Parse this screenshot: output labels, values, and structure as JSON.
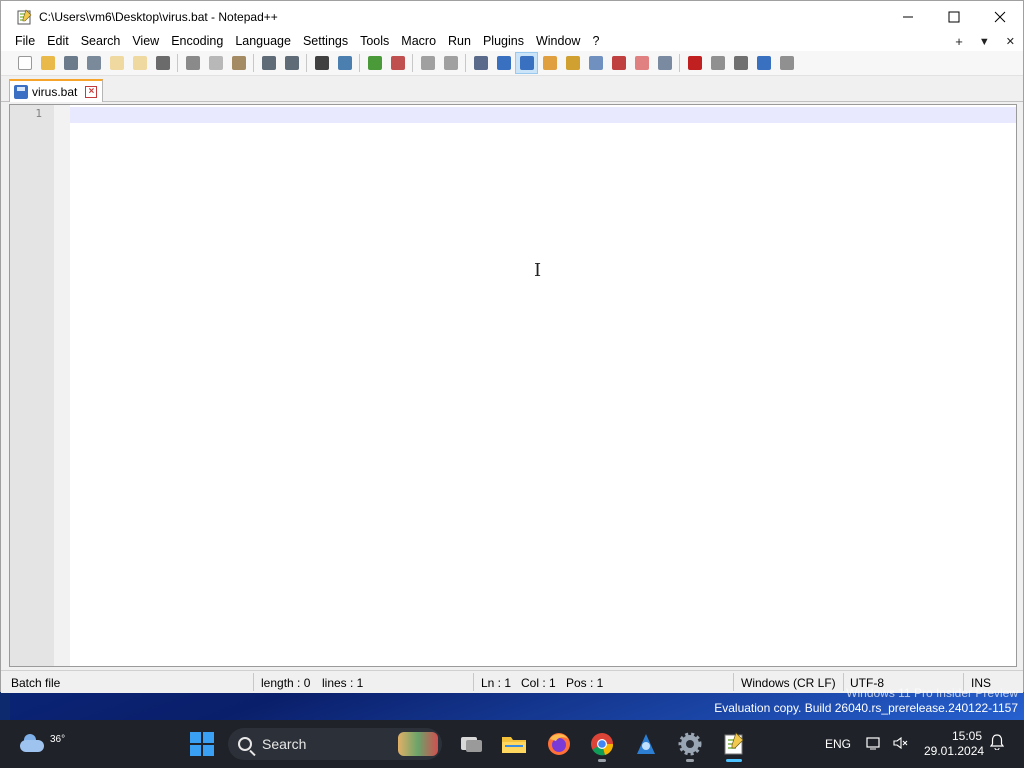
{
  "window": {
    "title": "C:\\Users\\vm6\\Desktop\\virus.bat - Notepad++",
    "controls": [
      "minimize-icon",
      "maximize-icon",
      "close-icon"
    ]
  },
  "menu": {
    "items": [
      "File",
      "Edit",
      "Search",
      "View",
      "Encoding",
      "Language",
      "Settings",
      "Tools",
      "Macro",
      "Run",
      "Plugins",
      "Window",
      "?"
    ],
    "right": [
      "+",
      "▼",
      "✕"
    ]
  },
  "toolbar": {
    "buttons": [
      {
        "name": "new-file-icon",
        "color": "#ffffff"
      },
      {
        "name": "open-file-icon",
        "color": "#e9b949"
      },
      {
        "name": "save-icon",
        "color": "#6b7b8c"
      },
      {
        "name": "save-all-icon",
        "color": "#7a8a9a"
      },
      {
        "name": "close-file-icon",
        "color": "#f0d9a0"
      },
      {
        "name": "close-all-icon",
        "color": "#f0d9a0"
      },
      {
        "name": "print-icon",
        "color": "#6b6b6b"
      },
      {
        "name": "sep"
      },
      {
        "name": "cut-icon",
        "color": "#8a8a8a"
      },
      {
        "name": "copy-icon",
        "color": "#b8b8b8"
      },
      {
        "name": "paste-icon",
        "color": "#a58b63"
      },
      {
        "name": "sep"
      },
      {
        "name": "undo-icon",
        "color": "#606b78"
      },
      {
        "name": "redo-icon",
        "color": "#606b78"
      },
      {
        "name": "sep"
      },
      {
        "name": "find-icon",
        "color": "#404040"
      },
      {
        "name": "replace-icon",
        "color": "#4a7fb0"
      },
      {
        "name": "sep"
      },
      {
        "name": "zoom-in-icon",
        "color": "#4a9a3a"
      },
      {
        "name": "zoom-out-icon",
        "color": "#c05050"
      },
      {
        "name": "sep"
      },
      {
        "name": "sync-vertical-icon",
        "color": "#a0a0a0"
      },
      {
        "name": "sync-horizontal-icon",
        "color": "#a0a0a0"
      },
      {
        "name": "sep"
      },
      {
        "name": "word-wrap-icon",
        "color": "#5a6a8a"
      },
      {
        "name": "show-all-chars-icon",
        "color": "#3a70c0"
      },
      {
        "name": "indent-guide-icon",
        "color": "#3a70c0",
        "active": true
      },
      {
        "name": "udl-icon",
        "color": "#e0a040"
      },
      {
        "name": "doc-map-icon",
        "color": "#d0a030"
      },
      {
        "name": "doc-list-icon",
        "color": "#7090c0"
      },
      {
        "name": "function-list-icon",
        "color": "#c04040"
      },
      {
        "name": "folder-as-workspace-icon",
        "color": "#e08080"
      },
      {
        "name": "monitoring-icon",
        "color": "#7a8aa0"
      },
      {
        "name": "sep"
      },
      {
        "name": "record-macro-icon",
        "color": "#c02020"
      },
      {
        "name": "stop-record-icon",
        "color": "#909090"
      },
      {
        "name": "playback-icon",
        "color": "#707070"
      },
      {
        "name": "run-macro-multiple-icon",
        "color": "#3a70c0"
      },
      {
        "name": "save-macro-icon",
        "color": "#909090"
      }
    ]
  },
  "tabs": [
    {
      "label": "virus.bat",
      "icon": "save-icon",
      "close_icon": "close-tab-icon"
    }
  ],
  "editor": {
    "line_numbers": [
      "1"
    ],
    "content": ""
  },
  "statusbar": {
    "file_type": "Batch file",
    "length": "length : 0",
    "lines": "lines : 1",
    "ln": "Ln : 1",
    "col": "Col : 1",
    "pos": "Pos : 1",
    "eol": "Windows (CR LF)",
    "encoding": "UTF-8",
    "mode": "INS"
  },
  "watermark": {
    "line1": "Windows 11 Pro Insider Preview",
    "line2": "Evaluation copy. Build 26040.rs_prerelease.240122-1157"
  },
  "taskbar": {
    "weather_temp": "36°",
    "search_placeholder": "Search",
    "apps": [
      "task-view-icon",
      "file-explorer-icon",
      "firefox-icon",
      "chrome-icon",
      "app-icon",
      "settings-icon",
      "notepadpp-icon"
    ],
    "language": "ENG",
    "time": "15:05",
    "date": "29.01.2024"
  }
}
